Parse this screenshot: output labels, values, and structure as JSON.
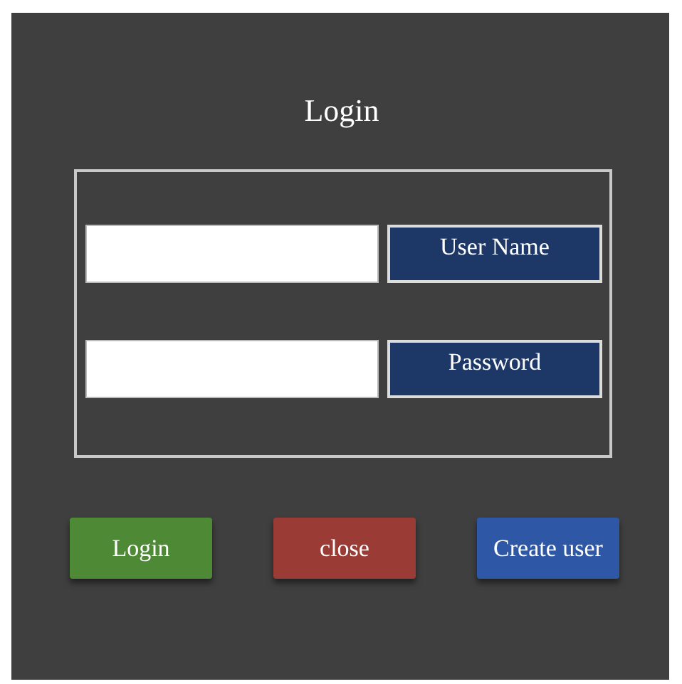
{
  "title": "Login",
  "fields": [
    {
      "label": "User Name"
    },
    {
      "label": "Password"
    }
  ],
  "buttons": [
    {
      "label": "Login",
      "color": "#4e8a36"
    },
    {
      "label": "close",
      "color": "#9a3b36"
    },
    {
      "label": "Create user",
      "color": "#2e58a6"
    }
  ]
}
